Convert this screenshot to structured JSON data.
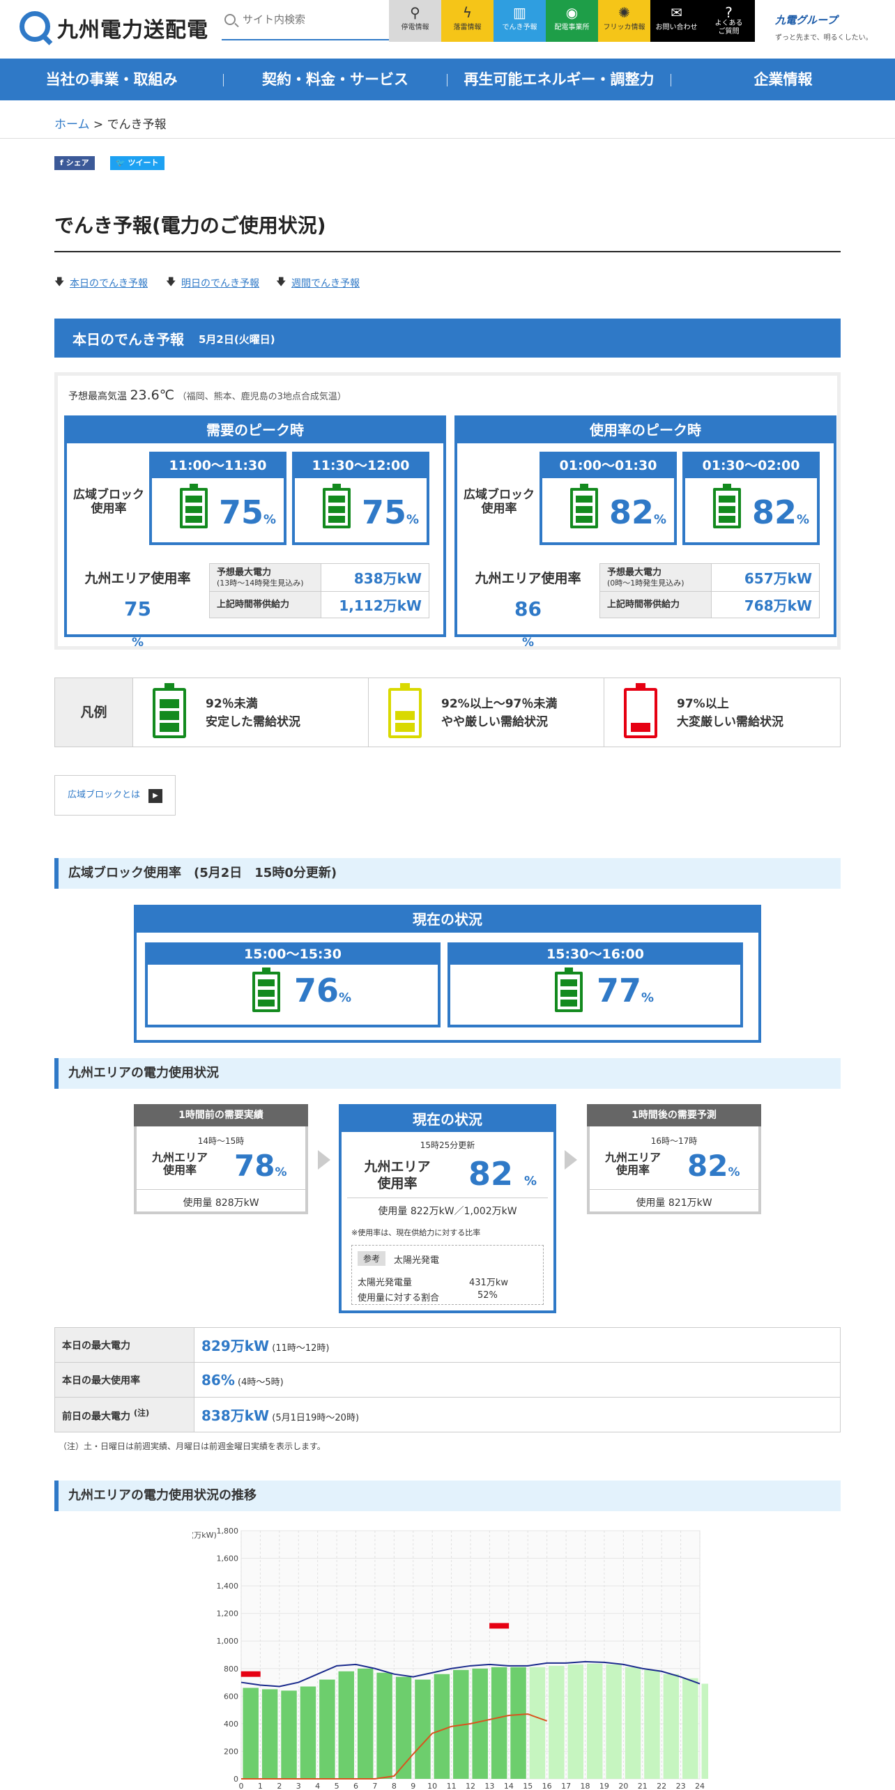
{
  "header": {
    "brand": "九州電力送配電",
    "search_placeholder": "サイト内検索",
    "tiles": [
      {
        "label": "停電情報",
        "glyph": "⚲",
        "bg": "#d9d9d9",
        "fg": "#333"
      },
      {
        "label": "落雷情報",
        "glyph": "ϟ",
        "bg": "#f5c518",
        "fg": "#333"
      },
      {
        "label": "でんき予報",
        "glyph": "▥",
        "bg": "#2f9ee0",
        "fg": "#fff"
      },
      {
        "label": "配電事業所",
        "glyph": "◉",
        "bg": "#1e9e48",
        "fg": "#fff"
      },
      {
        "label": "フリッカ情報",
        "glyph": "✺",
        "bg": "#f5c518",
        "fg": "#333"
      },
      {
        "label": "お問い合わせ",
        "glyph": "✉",
        "bg": "#000",
        "fg": "#fff"
      },
      {
        "label": "よくある\nご質問",
        "glyph": "?",
        "bg": "#000",
        "fg": "#fff"
      }
    ],
    "group_logo": "九電グループ",
    "group_tagline": "ずっと先まで、明るくしたい。"
  },
  "gnav": [
    "当社の事業・取組み",
    "契約・料金・サービス",
    "再生可能エネルギー・調整力",
    "企業情報"
  ],
  "breadcrumb": {
    "home": "ホーム",
    "sep": " > ",
    "current": "でんき予報"
  },
  "share": {
    "fb": "f シェア",
    "tw": "ツイート"
  },
  "page_title": "でんき予報(電力のご使用状況)",
  "anchors": [
    "本日のでんき予報",
    "明日のでんき予報",
    "週間でんき予報"
  ],
  "today": {
    "title": "本日のでんき予報",
    "date": "5月2日(火曜日)",
    "temp_label": "予想最高気温",
    "temp": "23.6℃",
    "temp_note": "（福岡、熊本、鹿児島の3地点合成気温）",
    "block_label": "広域ブロック\n使用率",
    "demand": {
      "head": "需要のピーク時",
      "slots": [
        {
          "time": "11:00～11:30",
          "value": 75
        },
        {
          "time": "11:30～12:00",
          "value": 75
        }
      ],
      "area_label": "九州エリア使用率",
      "area_value": "75",
      "max_label": "予想最大電力",
      "max_note": "(13時〜14時発生見込み)",
      "max_value": "838万kW",
      "supply_label": "上記時間帯供給力",
      "supply_value": "1,112万kW"
    },
    "usage": {
      "head": "使用率のピーク時",
      "slots": [
        {
          "time": "01:00～01:30",
          "value": 82
        },
        {
          "time": "01:30～02:00",
          "value": 82
        }
      ],
      "area_label": "九州エリア使用率",
      "area_value": "86",
      "max_label": "予想最大電力",
      "max_note": "(0時〜1時発生見込み)",
      "max_value": "657万kW",
      "supply_label": "上記時間帯供給力",
      "supply_value": "768万kW"
    },
    "pct": "%"
  },
  "legend": {
    "head": "凡例",
    "items": [
      {
        "l1": "92％未満",
        "l2": "安定した需給状況",
        "color": "#138a1e",
        "level": 3
      },
      {
        "l1": "92%以上～97％未満",
        "l2": "やや厳しい需給状況",
        "color": "#d9d900",
        "level": 2
      },
      {
        "l1": "97%以上",
        "l2": "大変厳しい需給状況",
        "color": "#e60012",
        "level": 1
      }
    ]
  },
  "area_link": "広域ブロックとは",
  "block_sec": "広域ブロック使用率　(5月2日　15時0分更新)",
  "current": {
    "head": "現在の状況",
    "slots": [
      {
        "time": "15:00～15:30",
        "value": 76
      },
      {
        "time": "15:30～16:00",
        "value": 77
      }
    ]
  },
  "kyushu_sec": "九州エリアの電力使用状況",
  "kyushu": {
    "prev": {
      "head": "1時間前の需要実績",
      "time": "14時～15時",
      "label": "九州エリア\n使用率",
      "value": "78",
      "usage": "使用量 828万kW"
    },
    "cur": {
      "head": "現在の状況",
      "time": "15時25分更新",
      "label": "九州エリア\n使用率",
      "value": "82",
      "usage": "使用量 822万kW／1,002万kW",
      "note": "※使用率は、現在供給力に対する比率",
      "ref_tag": "参考",
      "ref_title": "太陽光発電",
      "solar_label": "太陽光発電量",
      "solar_value": "431万kw",
      "ratio_label": "使用量に対する割合",
      "ratio_value": "52%"
    },
    "next": {
      "head": "1時間後の需要予測",
      "time": "16時～17時",
      "label": "九州エリア\n使用率",
      "value": "82",
      "usage": "使用量 821万kW"
    }
  },
  "max_table": [
    {
      "k": "本日の最大電力",
      "v": "829万kW",
      "s": "(11時〜12時)"
    },
    {
      "k": "本日の最大使用率",
      "v": "86%",
      "s": "(4時〜5時)"
    },
    {
      "k": "前日の最大電力",
      "sup": "(注)",
      "v": "838万kW",
      "s": "(5月1日19時〜20時)"
    }
  ],
  "note": "（注）土・日曜日は前週実績、月曜日は前週金曜日実績を表示します。",
  "trend_sec": "九州エリアの電力使用状況の推移",
  "chart_data": {
    "type": "bar",
    "ylabel": "(万kW)",
    "ylim": [
      0,
      1800
    ],
    "yticks": [
      "0",
      "200",
      "400",
      "600",
      "800",
      "1,000",
      "1,200",
      "1,400",
      "1,600",
      "1,800"
    ],
    "x": [
      "0",
      "1",
      "2",
      "3",
      "4",
      "5",
      "6",
      "7",
      "8",
      "9",
      "10",
      "11",
      "12",
      "13",
      "14",
      "15",
      "16",
      "17",
      "18",
      "19",
      "20",
      "21",
      "22",
      "23",
      "24"
    ],
    "actual": [
      660,
      650,
      640,
      670,
      720,
      780,
      800,
      770,
      740,
      720,
      760,
      790,
      800,
      810,
      810
    ],
    "forecast": [
      810,
      820,
      830,
      835,
      830,
      810,
      790,
      760,
      730,
      690
    ],
    "supply_line": [
      700,
      680,
      670,
      700,
      760,
      820,
      830,
      800,
      760,
      740,
      770,
      800,
      820,
      830,
      820,
      820,
      840,
      840,
      850,
      845,
      830,
      800,
      780,
      740,
      690
    ],
    "solar": [
      0,
      0,
      0,
      0,
      0,
      0,
      0,
      0,
      20,
      180,
      330,
      380,
      400,
      430,
      460,
      470,
      420
    ],
    "peak_markers": [
      {
        "x": 0.5,
        "y": 760
      },
      {
        "x": 13.5,
        "y": 1110
      }
    ],
    "colors": {
      "actual": "#6dce6d",
      "forecast": "#c6f5c0",
      "solar": "#d9531e",
      "supply": "#1a2a8c"
    }
  }
}
